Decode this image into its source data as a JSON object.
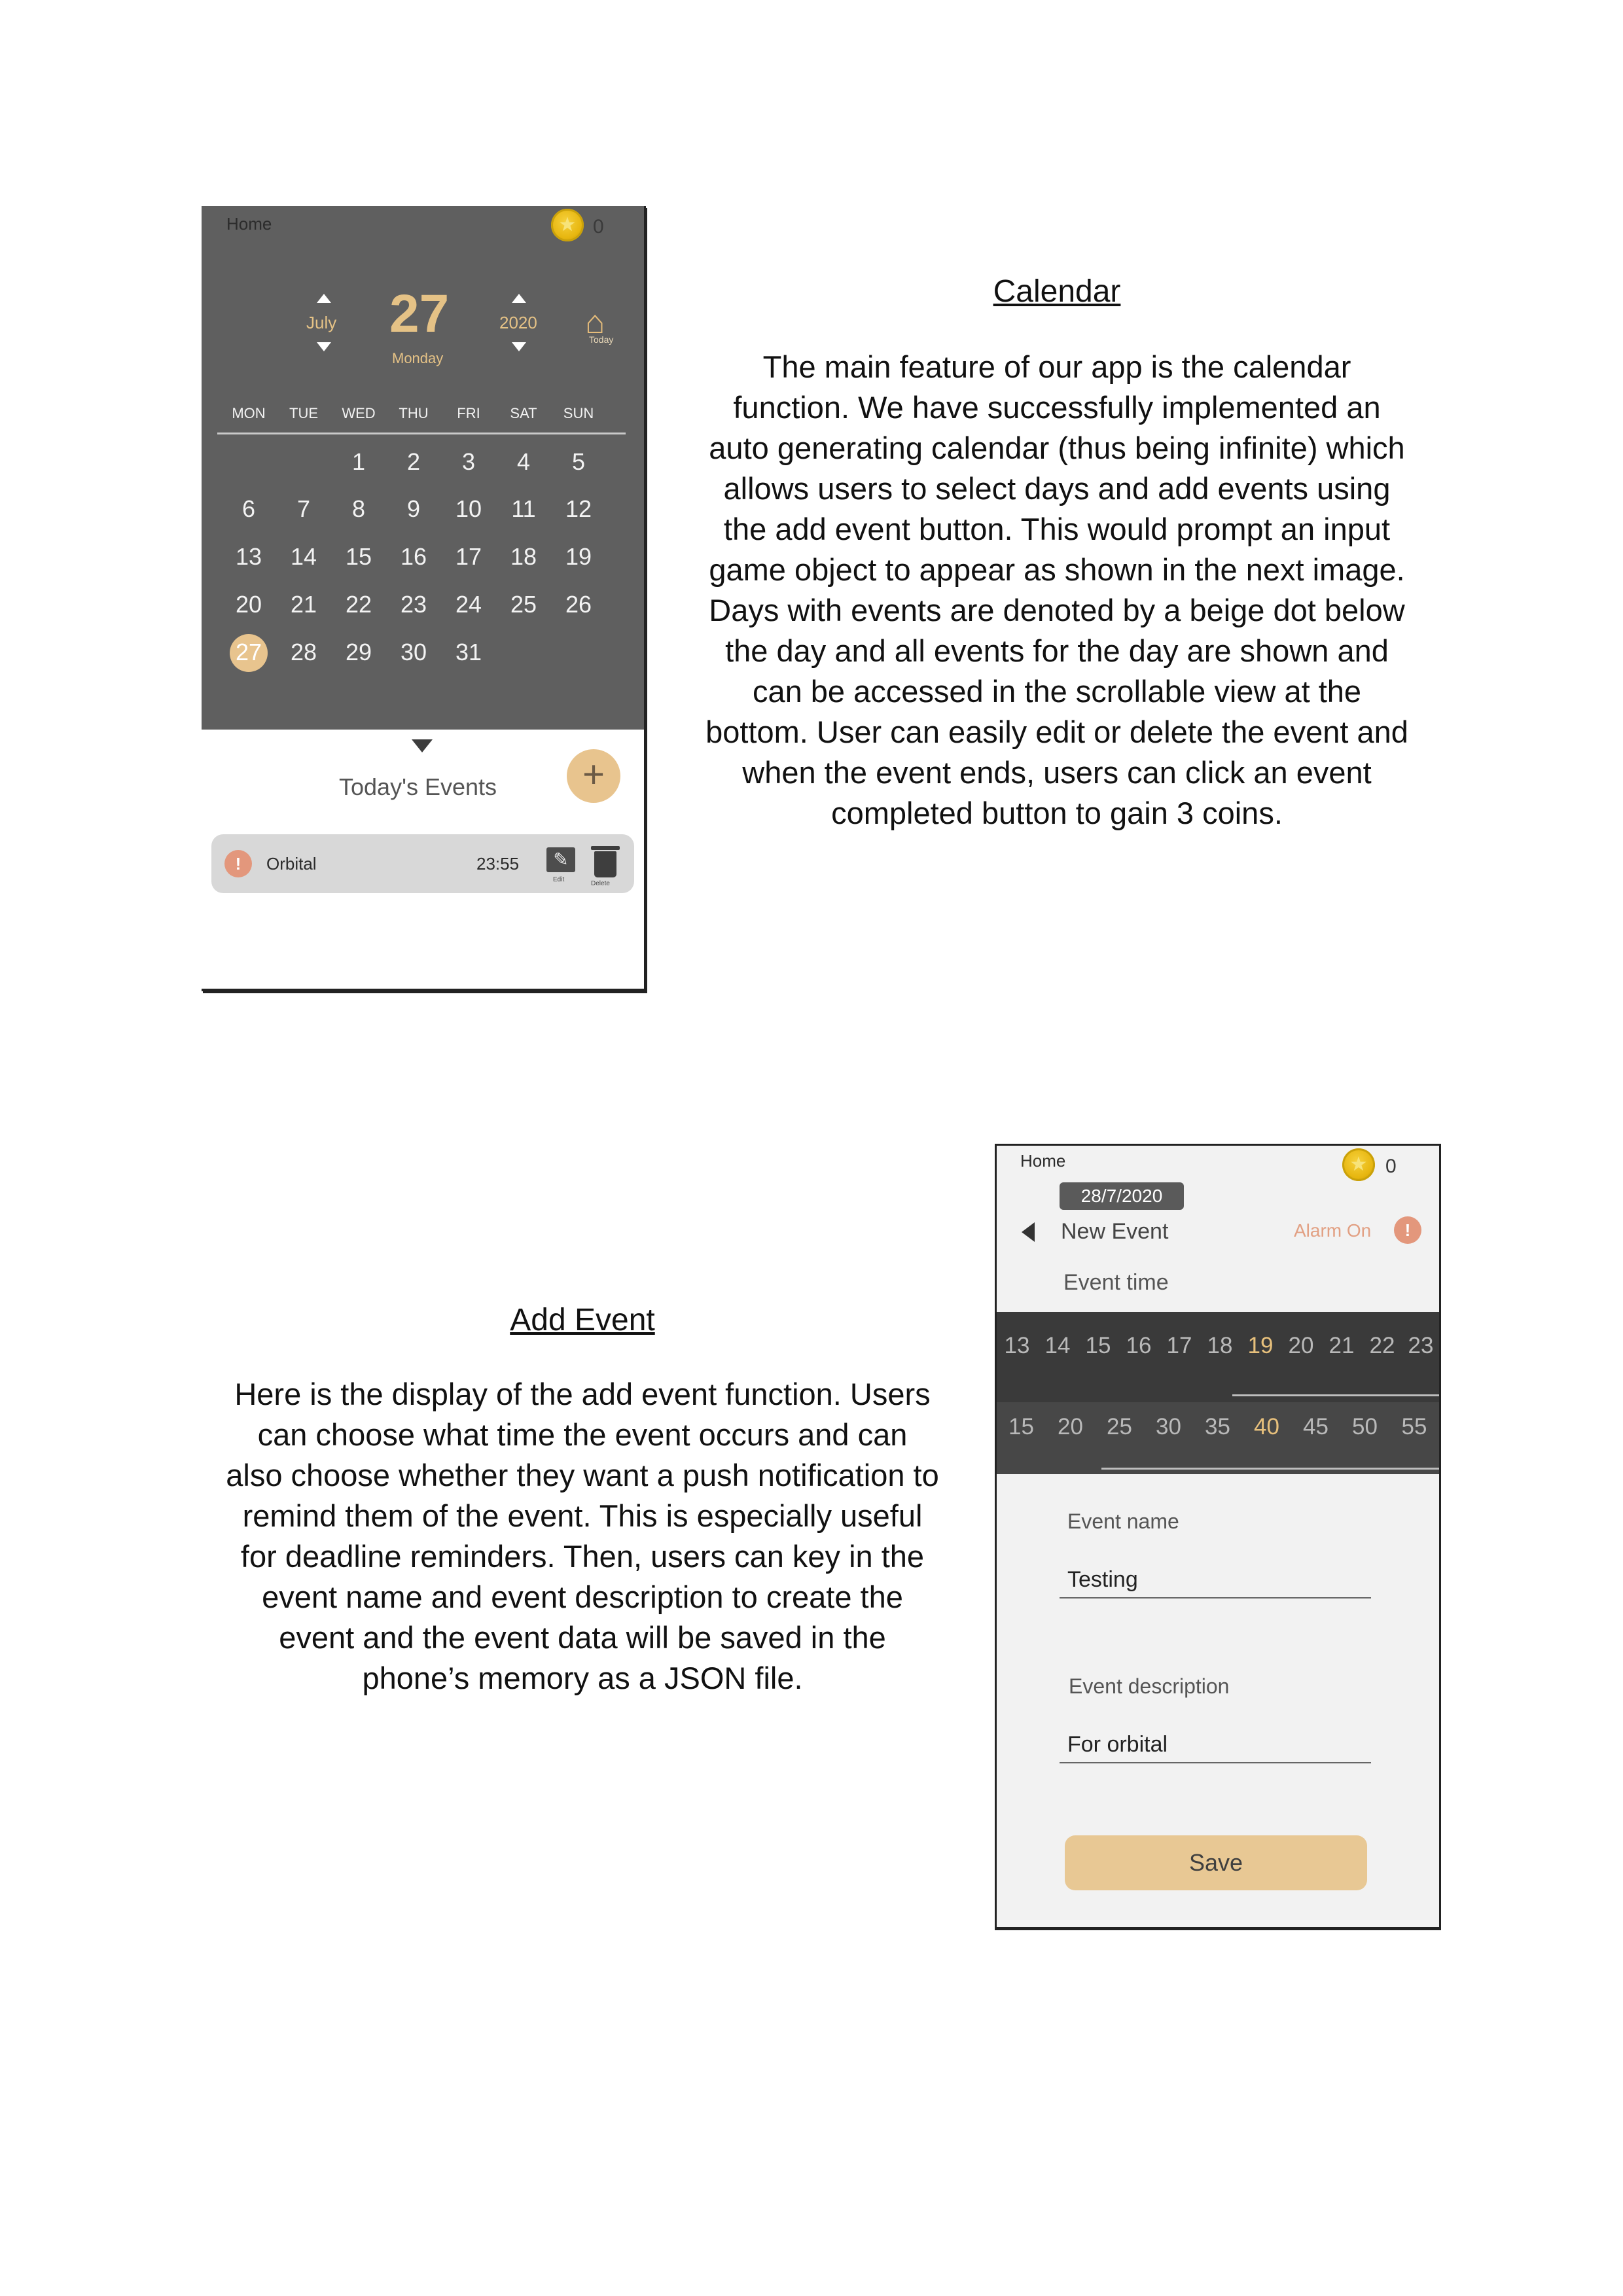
{
  "calendar_screen": {
    "home_label": "Home",
    "coin_count": "0",
    "month": "July",
    "day": "27",
    "year": "2020",
    "weekday": "Monday",
    "today_label": "Today",
    "days_of_week": [
      "MON",
      "TUE",
      "WED",
      "THU",
      "FRI",
      "SAT",
      "SUN"
    ],
    "weeks": [
      [
        "",
        "",
        "1",
        "2",
        "3",
        "4",
        "5"
      ],
      [
        "6",
        "7",
        "8",
        "9",
        "10",
        "11",
        "12"
      ],
      [
        "13",
        "14",
        "15",
        "16",
        "17",
        "18",
        "19"
      ],
      [
        "20",
        "21",
        "22",
        "23",
        "24",
        "25",
        "26"
      ],
      [
        "27",
        "28",
        "29",
        "30",
        "31",
        "",
        ""
      ]
    ],
    "selected_day": "27",
    "todays_events_title": "Today's Events",
    "add_button": "+",
    "event": {
      "name": "Orbital",
      "time": "23:55",
      "edit_label": "Edit",
      "delete_label": "Delete"
    },
    "accent_color": "#e8c48e",
    "header_color": "#5f5f5f"
  },
  "calendar_section": {
    "title": "Calendar",
    "lines": [
      "The main feature of our app is the calendar",
      "function. We have successfully implemented an",
      "auto generating calendar (thus being infinite) which",
      "allows users to select days and add events using",
      "the add event button. This would prompt an input",
      "game object to appear as shown in the next image.",
      "Days with events are denoted by a beige dot below",
      "the day and all events for the day are shown and",
      "can be accessed in the scrollable view at the",
      "bottom. User can easily edit or delete the event and",
      "when the event ends, users can click an event",
      "completed button to gain 3 coins."
    ]
  },
  "add_event_section": {
    "title": "Add Event",
    "lines": [
      "Here is the display of the add event function. Users",
      "can choose what time the event occurs and can",
      "also choose whether they want a push notification to",
      "remind them of the event. This is especially useful",
      "for deadline reminders. Then, users can key in the",
      "event name and event description to create the",
      "event and the event data will be saved in the",
      "phone’s memory as a JSON file."
    ]
  },
  "add_event_screen": {
    "home_label": "Home",
    "coin_count": "0",
    "date": "28/7/2020",
    "title": "New Event",
    "alarm_label": "Alarm On",
    "event_time_label": "Event time",
    "hours": [
      "13",
      "14",
      "15",
      "16",
      "17",
      "18",
      "19",
      "20",
      "21",
      "22",
      "23"
    ],
    "selected_hour": "19",
    "minutes": [
      "15",
      "20",
      "25",
      "30",
      "35",
      "40",
      "45",
      "50",
      "55"
    ],
    "selected_minute": "40",
    "name_label": "Event name",
    "name_value": "Testing",
    "description_label": "Event description",
    "description_value": "For orbital",
    "save_label": "Save"
  }
}
